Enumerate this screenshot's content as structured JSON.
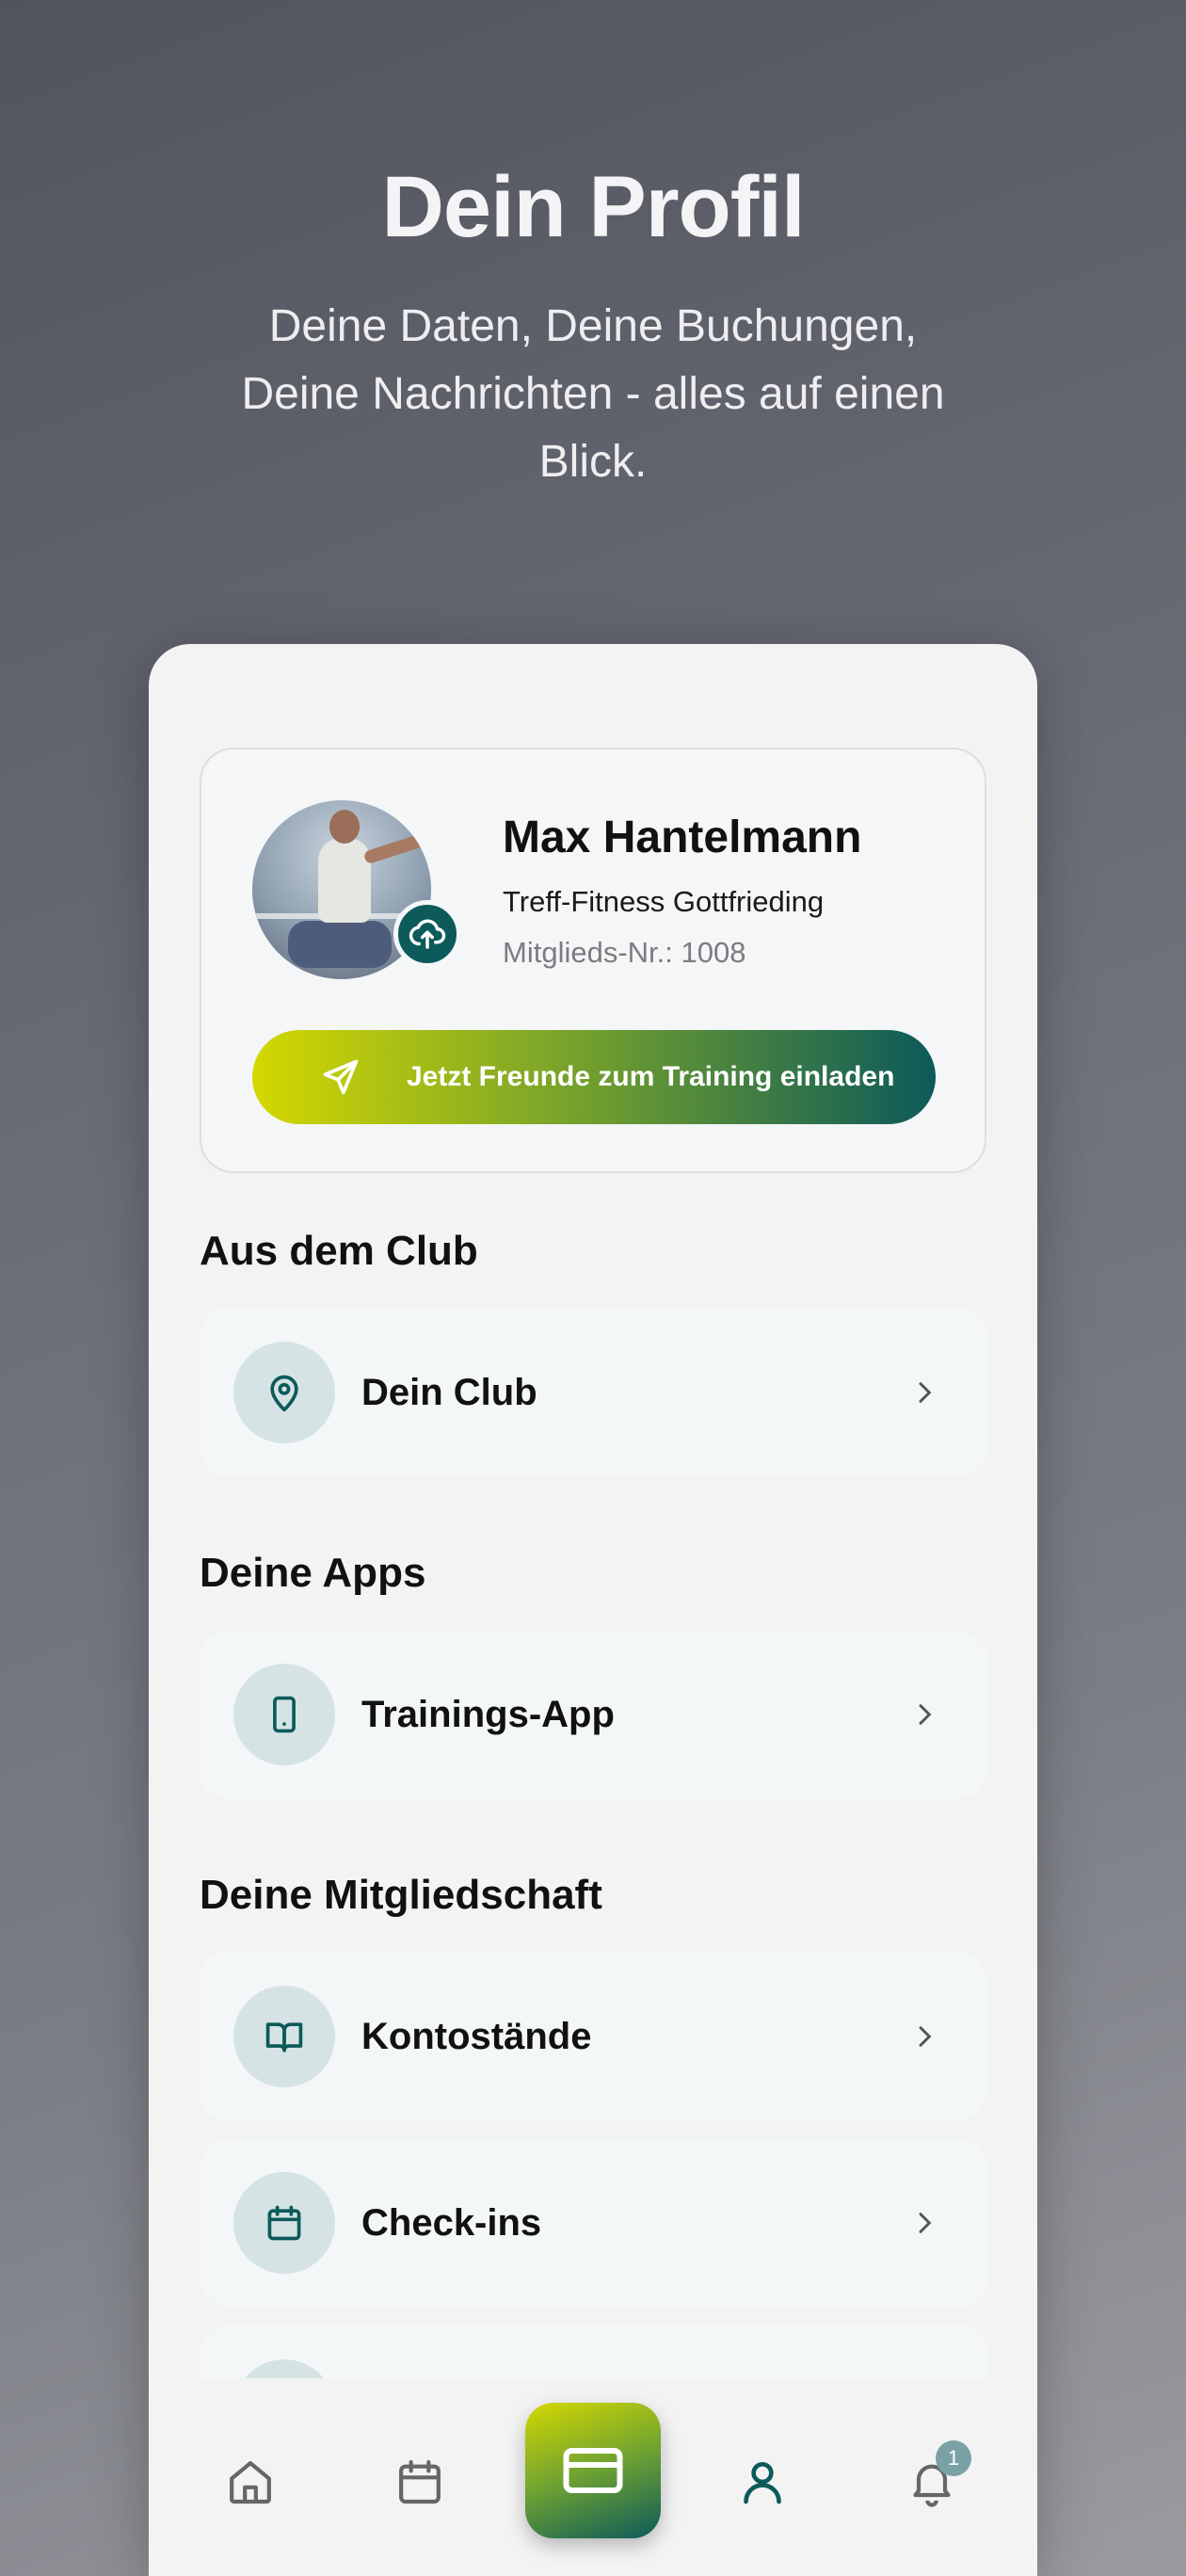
{
  "hero": {
    "title": "Dein Profil",
    "subtitle": "Deine Daten, Deine Buchungen, Deine Nachrichten - alles auf einen Blick."
  },
  "profile": {
    "name": "Max Hantelmann",
    "club": "Treff-Fitness Gottfrieding",
    "member_no": "Mitglieds-Nr.: 1008",
    "invite_label": "Jetzt Freunde zum Training einladen"
  },
  "sections": {
    "club": {
      "title": "Aus dem Club",
      "items": [
        {
          "label": "Dein Club",
          "icon": "location-pin-icon"
        }
      ]
    },
    "apps": {
      "title": "Deine Apps",
      "items": [
        {
          "label": "Trainings-App",
          "icon": "phone-icon"
        }
      ]
    },
    "membership": {
      "title": "Deine Mitgliedschaft",
      "items": [
        {
          "label": "Kontostände",
          "icon": "book-icon"
        },
        {
          "label": "Check-ins",
          "icon": "calendar-icon"
        }
      ]
    }
  },
  "nav": {
    "items": [
      "home-icon",
      "calendar-icon",
      "card-icon",
      "profile-icon",
      "bell-icon"
    ],
    "notification_count": "1"
  },
  "colors": {
    "accent": "#0c5a5a",
    "lime": "#d4d800",
    "icon_bg": "#d6e3e4"
  }
}
